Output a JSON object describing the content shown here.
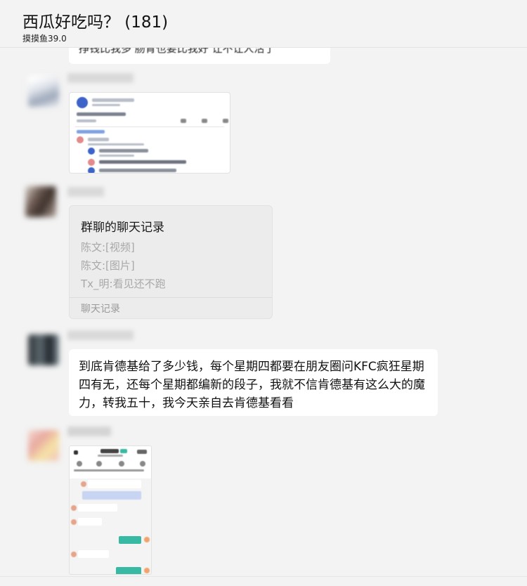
{
  "window": {
    "title": "西瓜好吃吗？ (181)",
    "subtitle": "摸摸鱼39.0"
  },
  "messages": [
    {
      "type": "text-cut",
      "text": "挣钱比我多 肠胃也要比我好 让不让人活了"
    },
    {
      "type": "image",
      "content": "screenshot"
    },
    {
      "type": "chat-history",
      "title": "群聊的聊天记录",
      "lines": [
        "陈文:[视频]",
        "陈文:[图片]",
        "Tx_明:看见还不跑"
      ],
      "footer": "聊天记录"
    },
    {
      "type": "text",
      "text": "到底肯德基给了多少钱，每个星期四都要在朋友圈问KFC疯狂星期四有无，还每个星期都编新的段子，我就不信肯德基有这么大的魔力，转我五十，我今天亲自去肯德基看看"
    },
    {
      "type": "image",
      "content": "phone-screenshot"
    }
  ],
  "colors": {
    "background": "#f3f3f3",
    "bubble": "#ffffff",
    "history_card": "#ececec",
    "muted_text": "#a8a8a8",
    "accent_green": "#37b9a3"
  }
}
